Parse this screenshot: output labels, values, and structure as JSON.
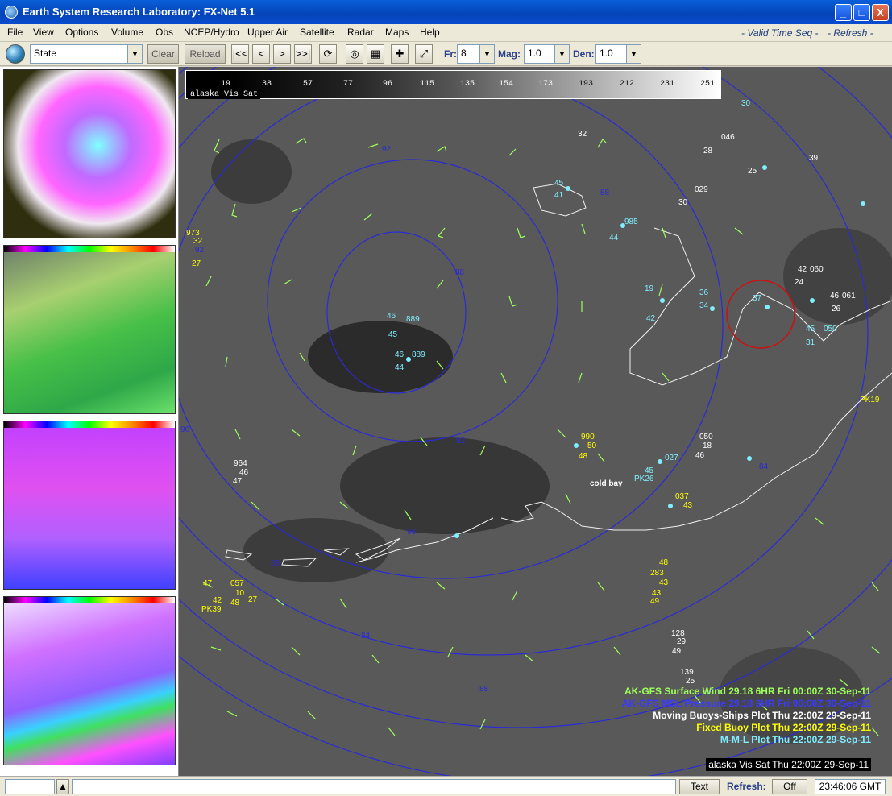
{
  "window": {
    "title": "Earth System Research Laboratory: FX-Net 5.1",
    "minimize": "_",
    "maximize": "□",
    "close": "X"
  },
  "menubar": {
    "items": [
      "File",
      "View",
      "Options",
      "Volume",
      "Obs",
      "NCEP/Hydro",
      "Upper Air",
      "Satellite",
      "Radar",
      "Maps",
      "Help"
    ],
    "valid_time_seq": "- Valid Time Seq -",
    "refresh": "- Refresh -"
  },
  "toolbar": {
    "region_select": "State",
    "clear_label": "Clear",
    "reload_label": "Reload",
    "first_frame_icon": "|<<",
    "prev_frame_icon": "<",
    "next_frame_icon": ">",
    "last_frame_icon": ">>|",
    "fr_label": "Fr:",
    "fr_value": "8",
    "mag_label": "Mag:",
    "mag_value": "1.0",
    "den_label": "Den:",
    "den_value": "1.0"
  },
  "colorscale": {
    "ticks": [
      "19",
      "38",
      "57",
      "77",
      "96",
      "115",
      "135",
      "154",
      "173",
      "193",
      "212",
      "231",
      "251"
    ],
    "label": "alaska Vis Sat"
  },
  "legend": [
    {
      "text": "AK-GFS Surface Wind  29.18   6HR Fri 00:00Z 30-Sep-11",
      "color": "#9cff5a"
    },
    {
      "text": "AK-GFS MSL Pressure  29.18   6HR Fri 00:00Z 30-Sep-11",
      "color": "#3a3aff"
    },
    {
      "text": "Moving Buoys-Ships Plot Thu 22:00Z 29-Sep-11",
      "color": "#ffffff"
    },
    {
      "text": "Fixed Buoy Plot Thu 22:00Z 29-Sep-11",
      "color": "#ffff00"
    },
    {
      "text": "M-M-L Plot Thu 22:00Z 29-Sep-11",
      "color": "#7fefff"
    }
  ],
  "timestamp": "alaska Vis Sat Thu 22:00Z 29-Sep-11",
  "map_labels": {
    "place": "cold bay",
    "isobars": [
      "92",
      "88",
      "92",
      "96",
      "88",
      "84",
      "88",
      "92",
      "96",
      "84",
      "88"
    ],
    "station_values": [
      "45",
      "41",
      "46",
      "889",
      "45",
      "46",
      "889",
      "44",
      "985",
      "44",
      "029",
      "30",
      "046",
      "28",
      "25",
      "32",
      "39",
      "37",
      "30",
      "050",
      "18",
      "46",
      "964",
      "46",
      "47",
      "973",
      "32",
      "27",
      "19",
      "42",
      "36",
      "34",
      "42",
      "060",
      "24",
      "46",
      "061",
      "26",
      "45",
      "050",
      "31",
      "128",
      "29",
      "49",
      "139",
      "25"
    ],
    "buoy_values": [
      "990",
      "48",
      "50",
      "027",
      "45",
      "037",
      "43",
      "43",
      "48",
      "283",
      "43",
      "49",
      "47",
      "057",
      "10",
      "27",
      "42",
      "48",
      "PK39",
      "PK26",
      "PK19"
    ]
  },
  "statusbar": {
    "text_button": "Text",
    "refresh_label": "Refresh:",
    "refresh_value": "Off",
    "clock": "23:46:06 GMT"
  }
}
